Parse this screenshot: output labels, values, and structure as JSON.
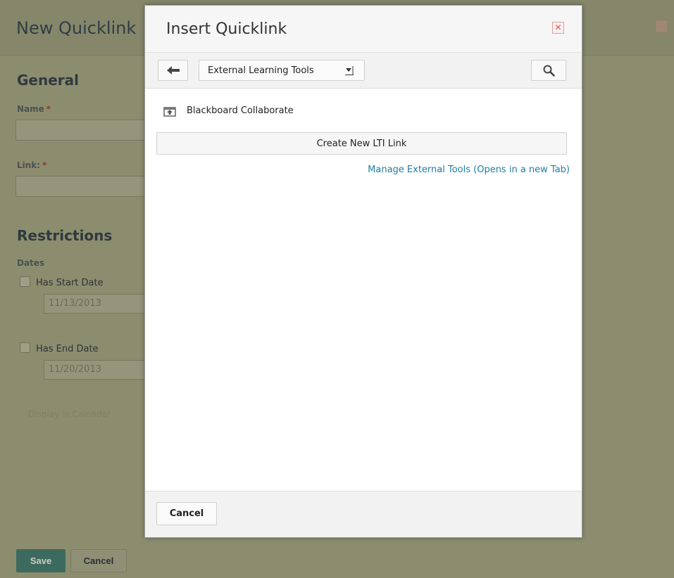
{
  "background_page": {
    "title": "New Quicklink",
    "general_heading": "General",
    "name_label": "Name",
    "link_label": "Link:",
    "required_marker": "*",
    "restrictions_heading": "Restrictions",
    "dates_label": "Dates",
    "has_start_date_label": "Has Start Date",
    "start_date_value": "11/13/2013",
    "has_end_date_label": "Has End Date",
    "end_date_value": "11/20/2013",
    "display_in_calendar_label": "Display in Calendar",
    "save_label": "Save",
    "cancel_label": "Cancel"
  },
  "dialog": {
    "title": "Insert Quicklink",
    "close_icon": "close-icon",
    "toolbar": {
      "back_icon": "arrow-left-icon",
      "category_select": {
        "selected": "External Learning Tools"
      },
      "search_icon": "search-icon"
    },
    "tools": [
      {
        "label": "Blackboard Collaborate",
        "icon": "external-tool-icon"
      }
    ],
    "create_button_label": "Create New LTI Link",
    "manage_link_label": "Manage External Tools (Opens in a new Tab)",
    "footer": {
      "cancel_label": "Cancel"
    }
  },
  "colors": {
    "overlay": "#8c8d6f",
    "link": "#1d7ea3",
    "save_button": "#3d6a5e",
    "close_red": "#d65b4f"
  }
}
